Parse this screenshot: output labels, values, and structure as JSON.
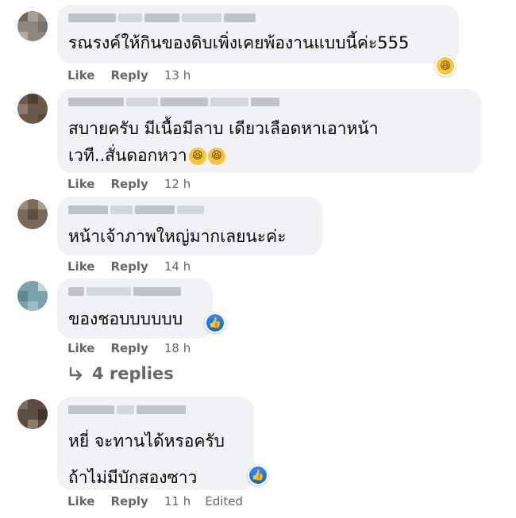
{
  "comments": [
    {
      "text_lines": [
        "รณรงค์ให้กินของดิบเพิ่งเคยพ้องานแบบนี้ค่ะ555"
      ],
      "reaction": "haha-icon",
      "like": "Like",
      "reply": "Reply",
      "time": "13 h",
      "edited": ""
    },
    {
      "text_lines": [
        "สบายครับ มีเนื้อมีลาบ เดียวเลือดหาเอาหน้า",
        "เวที..สั่นดอกหวา"
      ],
      "reaction": "",
      "like": "Like",
      "reply": "Reply",
      "time": "12 h",
      "edited": ""
    },
    {
      "text_lines": [
        "หน้าเจ้าภาพใหญ่มากเลยนะค่ะ"
      ],
      "reaction": "",
      "like": "Like",
      "reply": "Reply",
      "time": "14 h",
      "edited": ""
    },
    {
      "text_lines": [
        "ของชอบบบบบบ"
      ],
      "reaction": "like-icon",
      "like": "Like",
      "reply": "Reply",
      "time": "18 h",
      "edited": ""
    },
    {
      "text_lines": [
        "หยี่ จะทานได้หรอครับ",
        "ถ้าไม่มีบักสองซาว"
      ],
      "reaction": "like-icon",
      "like": "Like",
      "reply": "Reply",
      "time": "11 h",
      "edited": "Edited"
    }
  ],
  "replies_link": "4 replies",
  "colors": {
    "bubble": "#f0f2f5",
    "meta": "#65676b",
    "like_blue": "#1877f2",
    "haha_yellow": "#f7c43b"
  }
}
